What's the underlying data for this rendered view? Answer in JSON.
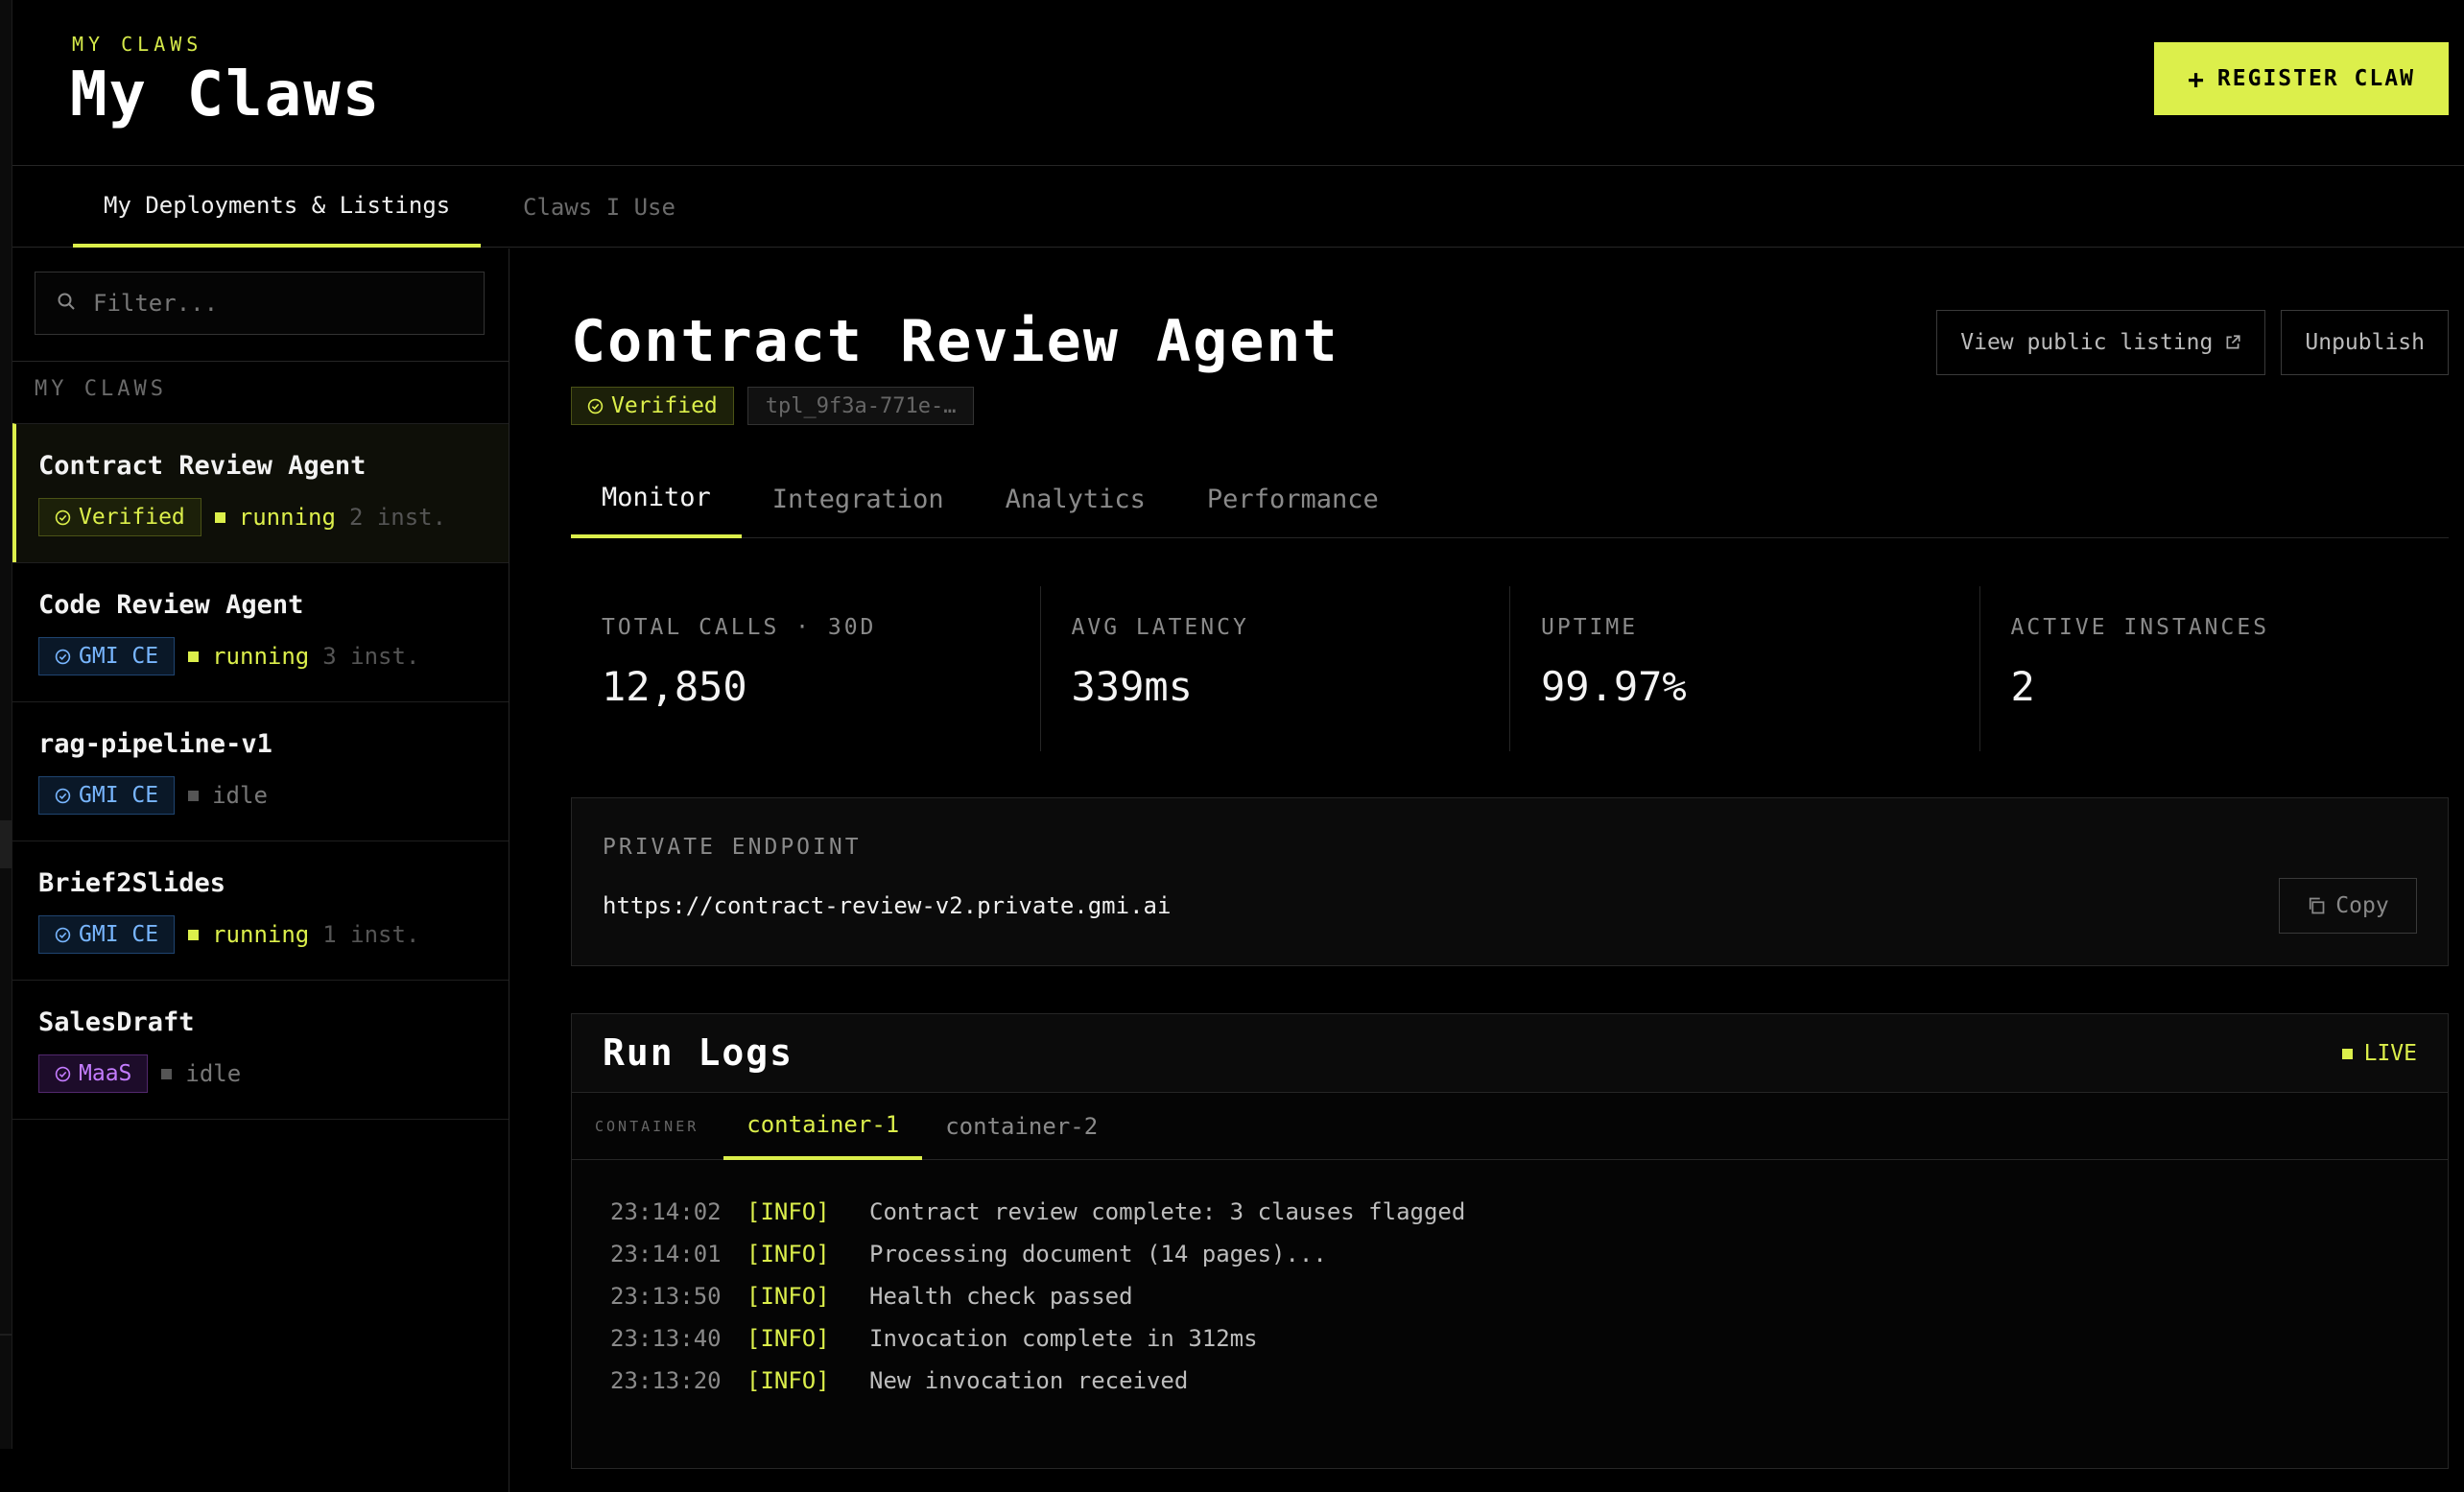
{
  "header": {
    "eyebrow": "MY CLAWS",
    "title": "My Claws",
    "register_label": "REGISTER CLAW"
  },
  "top_tabs": [
    {
      "label": "My Deployments & Listings",
      "active": true
    },
    {
      "label": "Claws I Use",
      "active": false
    }
  ],
  "sidebar": {
    "filter_placeholder": "Filter...",
    "section_label": "MY CLAWS",
    "items": [
      {
        "name": "Contract Review Agent",
        "badge": "Verified",
        "badge_type": "verified",
        "status": "running",
        "instances": "2 inst.",
        "selected": true
      },
      {
        "name": "Code Review Agent",
        "badge": "GMI CE",
        "badge_type": "gmi",
        "status": "running",
        "instances": "3 inst."
      },
      {
        "name": "rag-pipeline-v1",
        "badge": "GMI CE",
        "badge_type": "gmi",
        "status": "idle",
        "instances": ""
      },
      {
        "name": "Brief2Slides",
        "badge": "GMI CE",
        "badge_type": "gmi",
        "status": "running",
        "instances": "1 inst."
      },
      {
        "name": "SalesDraft",
        "badge": "MaaS",
        "badge_type": "maas",
        "status": "idle",
        "instances": ""
      }
    ]
  },
  "detail": {
    "title": "Contract Review Agent",
    "verified_label": "Verified",
    "template_id": "tpl_9f3a-771e-…",
    "view_listing_label": "View public listing",
    "unpublish_label": "Unpublish",
    "tabs": [
      {
        "label": "Monitor",
        "active": true
      },
      {
        "label": "Integration",
        "active": false
      },
      {
        "label": "Analytics",
        "active": false
      },
      {
        "label": "Performance",
        "active": false
      }
    ],
    "stats": [
      {
        "label": "TOTAL CALLS · 30D",
        "value": "12,850"
      },
      {
        "label": "AVG LATENCY",
        "value": "339ms"
      },
      {
        "label": "UPTIME",
        "value": "99.97%"
      },
      {
        "label": "ACTIVE INSTANCES",
        "value": "2"
      }
    ],
    "endpoint": {
      "label": "PRIVATE ENDPOINT",
      "url": "https://contract-review-v2.private.gmi.ai",
      "copy_label": "Copy"
    },
    "logs": {
      "title": "Run Logs",
      "live_label": "LIVE",
      "container_label": "CONTAINER",
      "containers": [
        {
          "label": "container-1",
          "active": true
        },
        {
          "label": "container-2",
          "active": false
        }
      ],
      "lines": [
        {
          "time": "23:14:02",
          "level": "[INFO]",
          "message": "Contract review complete: 3 clauses flagged"
        },
        {
          "time": "23:14:01",
          "level": "[INFO]",
          "message": "Processing document (14 pages)..."
        },
        {
          "time": "23:13:50",
          "level": "[INFO]",
          "message": "Health check passed"
        },
        {
          "time": "23:13:40",
          "level": "[INFO]",
          "message": "Invocation complete in 312ms"
        },
        {
          "time": "23:13:20",
          "level": "[INFO]",
          "message": "New invocation received"
        }
      ]
    }
  },
  "colors": {
    "accent": "#dcef4b",
    "background": "#000000",
    "gmi_badge": "#78b6ff",
    "maas_badge": "#c47cff"
  },
  "icons": [
    "plus-icon",
    "search-icon",
    "check-circle-icon",
    "external-link-icon",
    "copy-icon",
    "live-dot-icon"
  ]
}
